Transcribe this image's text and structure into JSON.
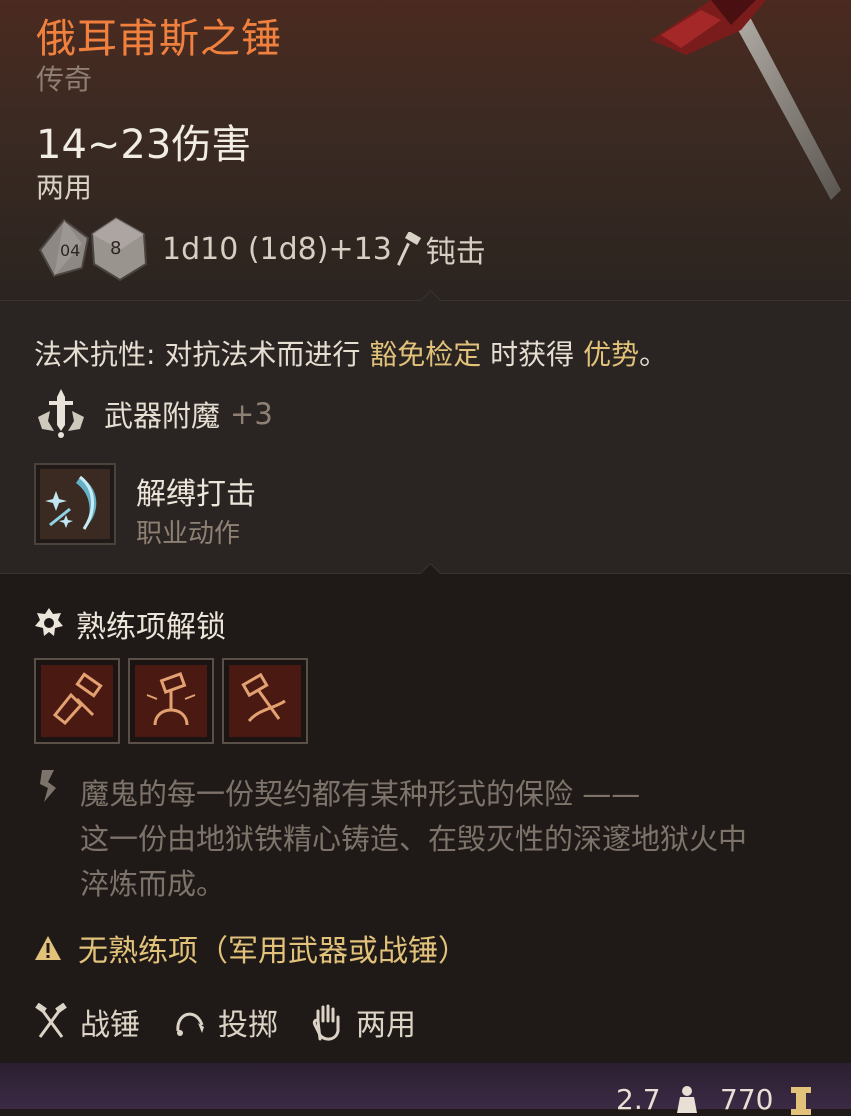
{
  "item": {
    "name": "俄耳甫斯之锤",
    "rarity": "传奇",
    "damage": "14~23伤害",
    "handedness": "两用",
    "dice_icons": [
      "d10-icon",
      "d8-icon"
    ],
    "dice_roll": "1d10 (1d8)+13",
    "damage_type": "钝击"
  },
  "passive": {
    "spell_resistance_prefix": "法术抗性: 对抗法术而进行 ",
    "spell_resistance_hl1": "豁免检定",
    "spell_resistance_mid": " 时获得 ",
    "spell_resistance_hl2": "优势",
    "spell_resistance_end": "。"
  },
  "enchantment": {
    "label": "武器附魔",
    "value": "+3"
  },
  "action": {
    "name": "解缚打击",
    "type": "职业动作"
  },
  "proficiency": {
    "title": "熟练项解锁",
    "tiles": [
      "proficiency-action-1-icon",
      "proficiency-action-2-icon",
      "proficiency-action-3-icon"
    ]
  },
  "lore": [
    "魔鬼的每一份契约都有某种形式的保险 ——",
    "这一份由地狱铁精心铸造、在毁灭性的深邃地狱火中",
    "淬炼而成。"
  ],
  "warning": "无熟练项（军用武器或战锤）",
  "tags": [
    "战锤",
    "投掷",
    "两用"
  ],
  "footer": {
    "weight": "2.7",
    "price": "770"
  },
  "colors": {
    "name": "#f0803e",
    "highlight": "#e2c27a",
    "muted": "#8e8174",
    "lore": "#7d736a"
  }
}
